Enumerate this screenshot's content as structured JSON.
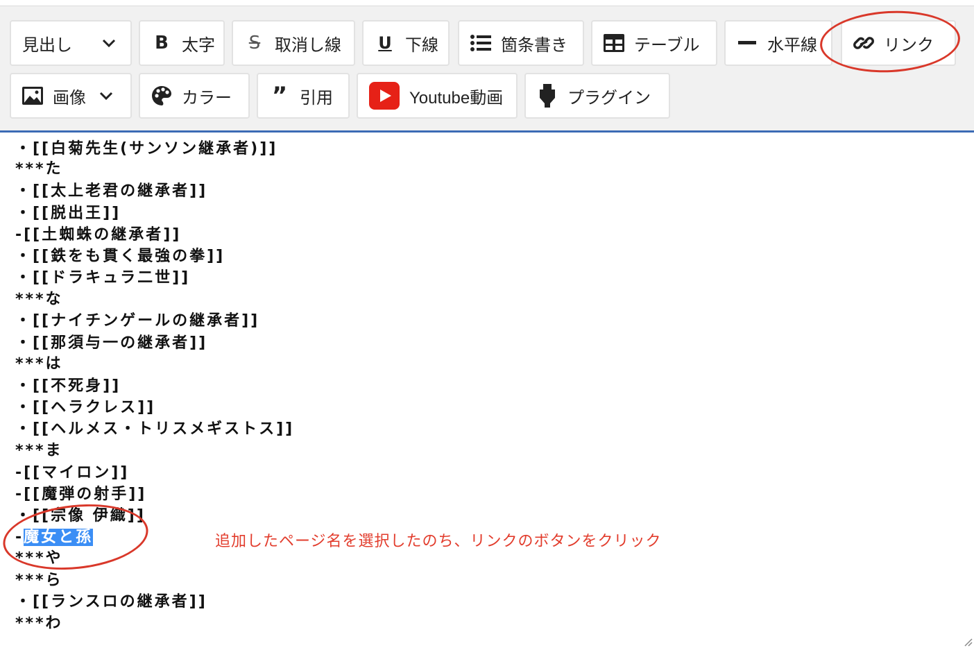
{
  "toolbar": {
    "row1": [
      {
        "id": "heading",
        "label": "見出し",
        "icon": "chevron-down-icon"
      },
      {
        "id": "bold",
        "label": "太字",
        "icon": "bold-icon"
      },
      {
        "id": "strike",
        "label": "取消し線",
        "icon": "strikethrough-icon"
      },
      {
        "id": "underline",
        "label": "下線",
        "icon": "underline-icon"
      },
      {
        "id": "bullets",
        "label": "箇条書き",
        "icon": "list-icon"
      },
      {
        "id": "table",
        "label": "テーブル",
        "icon": "table-icon"
      },
      {
        "id": "hr",
        "label": "水平線",
        "icon": "horizontal-rule-icon"
      },
      {
        "id": "link",
        "label": "リンク",
        "icon": "link-icon"
      }
    ],
    "row2": [
      {
        "id": "image",
        "label": "画像",
        "icon": "image-icon"
      },
      {
        "id": "color",
        "label": "カラー",
        "icon": "palette-icon"
      },
      {
        "id": "quote",
        "label": "引用",
        "icon": "quote-icon"
      },
      {
        "id": "youtube",
        "label": "Youtube動画",
        "icon": "youtube-icon"
      },
      {
        "id": "plugin",
        "label": "プラグイン",
        "icon": "plugin-icon"
      }
    ]
  },
  "editor": {
    "lines": [
      "・[[白菊先生(サンソン継承者)]]",
      "***た",
      "・[[太上老君の継承者]]",
      "・[[脱出王]]",
      "-[[土蜘蛛の継承者]]",
      "・[[鉄をも貫く最強の拳]]",
      "・[[ドラキュラ二世]]",
      "***な",
      "・[[ナイチンゲールの継承者]]",
      "・[[那須与一の継承者]]",
      "***は",
      "・[[不死身]]",
      "・[[ヘラクレス]]",
      "・[[ヘルメス・トリスメギストス]]",
      "***ま",
      "-[[マイロン]]",
      "-[[魔弾の射手]]",
      "・[[宗像 伊織]]",
      "***や",
      "***ら",
      "・[[ランスロの継承者]]",
      "***わ"
    ],
    "selected_line_prefix": "-",
    "selected_text": "魔女と孫"
  },
  "annotation": {
    "text": "追加したページ名を選択したのち、リンクのボタンをクリック",
    "color": "#e23c2c"
  },
  "colors": {
    "accent": "#3c6bb5",
    "selection": "#3b8ef5",
    "youtube": "#e62117"
  }
}
